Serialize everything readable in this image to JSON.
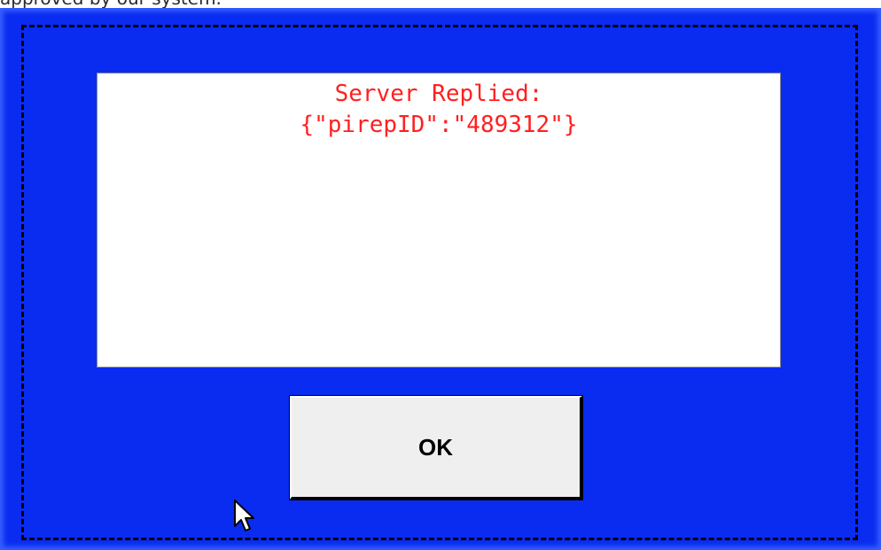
{
  "background": {
    "partial_text": "approved by our system."
  },
  "dialog": {
    "message_lines": [
      "Server Replied:",
      "{\"pirepID\":\"489312\"}"
    ],
    "ok_label": "OK"
  },
  "colors": {
    "dialog_background": "#0a2cf0",
    "message_text": "#ff2020",
    "button_face": "#efefef"
  },
  "icons": {
    "cursor": "mouse-pointer-icon"
  }
}
